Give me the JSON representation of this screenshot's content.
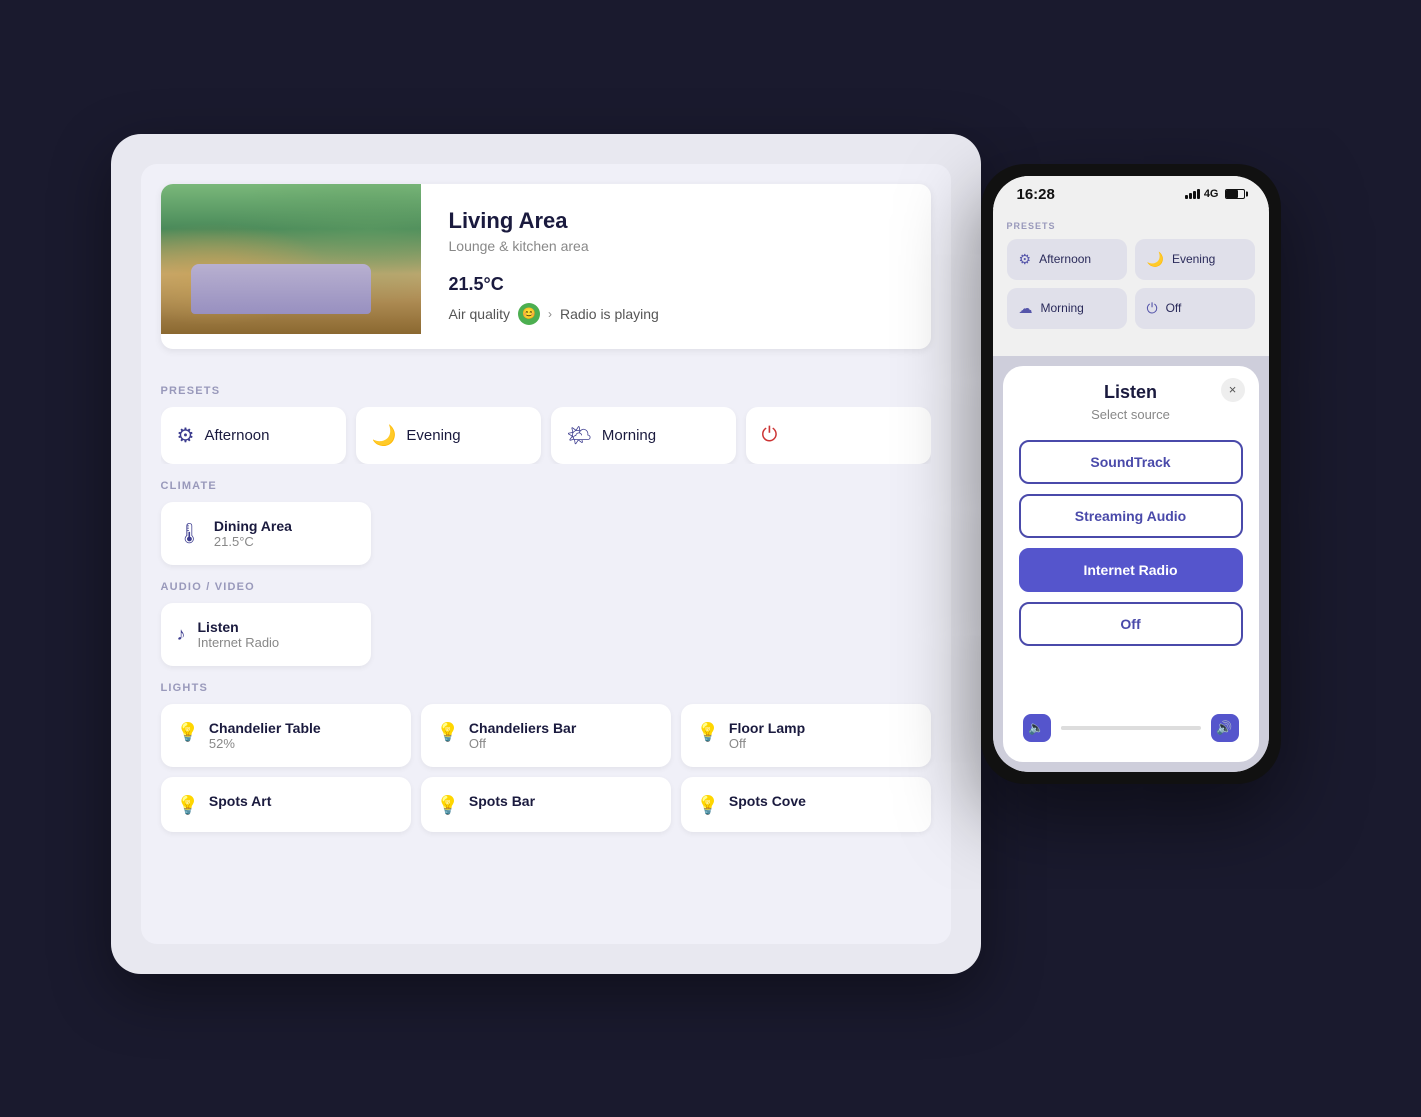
{
  "colors": {
    "accent": "#5555cc",
    "accent_light": "#4a4aaa",
    "bg": "#f0f0f8",
    "card_bg": "#ffffff",
    "text_primary": "#1a1a3e",
    "text_muted": "#888888",
    "section_label": "#9999bb"
  },
  "hero": {
    "title": "Living Area",
    "subtitle": "Lounge & kitchen area",
    "temperature": "21.5°C",
    "air_quality_label": "Air quality",
    "radio_status": "Radio is playing"
  },
  "sections": {
    "presets": "PRESETS",
    "climate": "CLIMATE",
    "audio_video": "AUDIO / VIDEO",
    "lights": "LIGHTS"
  },
  "presets": [
    {
      "name": "Afternoon",
      "icon": "⚙"
    },
    {
      "name": "Evening",
      "icon": "🌙"
    },
    {
      "name": "Morning",
      "icon": "🌤"
    },
    {
      "name": "Off",
      "icon": "⏻"
    }
  ],
  "climate": [
    {
      "name": "Dining Area",
      "temp": "21.5°C",
      "icon": "🌡"
    }
  ],
  "audio": [
    {
      "name": "Listen",
      "sub": "Internet Radio",
      "icon": "♪"
    }
  ],
  "lights": [
    {
      "name": "Chandelier Table",
      "value": "52%",
      "icon": "💡",
      "on": true
    },
    {
      "name": "Chandeliers Bar",
      "value": "Off",
      "icon": "💡",
      "on": false
    },
    {
      "name": "Floor Lamp",
      "value": "Off",
      "icon": "💡",
      "on": false
    }
  ],
  "lights_row2": [
    {
      "name": "Spots Art",
      "value": "",
      "icon": "💡",
      "on": false
    },
    {
      "name": "Spots Bar",
      "value": "",
      "icon": "💡",
      "on": false
    },
    {
      "name": "Spots Cove",
      "value": "",
      "icon": "💡",
      "on": false
    }
  ],
  "phone": {
    "time": "16:28",
    "signal_label": "4G",
    "presets_label": "PRESETS",
    "preset_items": [
      {
        "name": "Afternoon",
        "icon": "⚙"
      },
      {
        "name": "Evening",
        "icon": "🌙"
      },
      {
        "name": "Morning",
        "icon": "☁"
      },
      {
        "name": "Off",
        "icon": "⏻"
      }
    ],
    "modal": {
      "title": "Listen",
      "subtitle": "Select source",
      "close_label": "×",
      "sources": [
        {
          "name": "SoundTrack",
          "active": false
        },
        {
          "name": "Streaming Audio",
          "active": false
        },
        {
          "name": "Internet Radio",
          "active": true
        },
        {
          "name": "Off",
          "active": false
        }
      ]
    }
  }
}
